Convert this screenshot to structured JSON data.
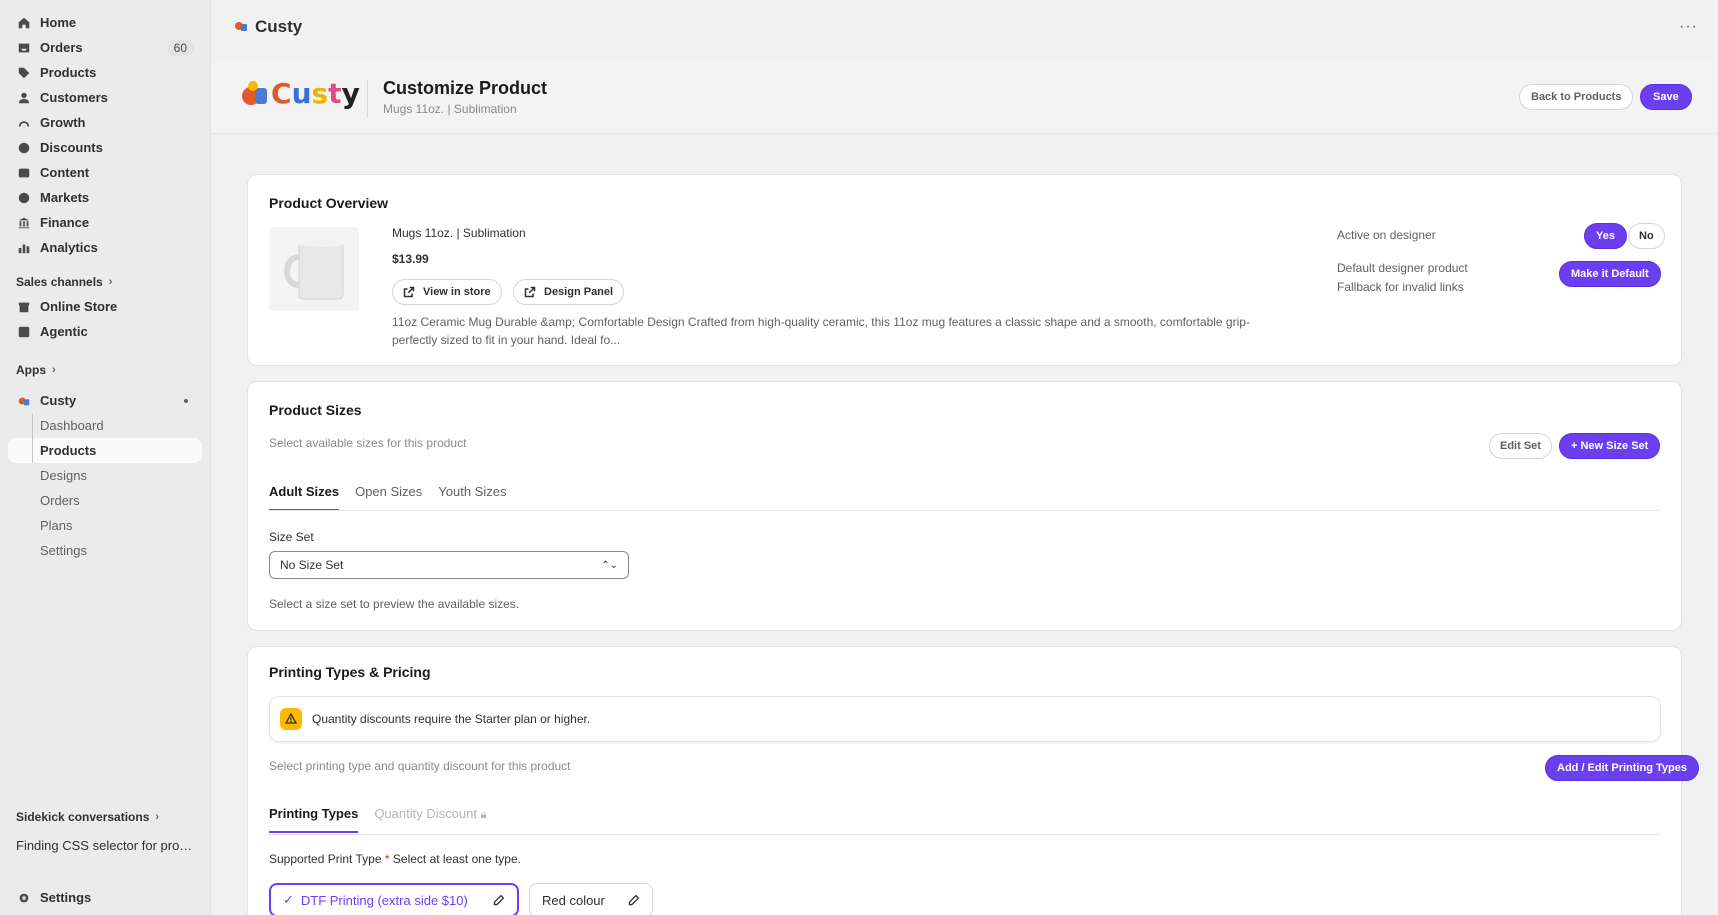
{
  "sidebar": {
    "nav": [
      {
        "label": "Home",
        "icon": "home-icon"
      },
      {
        "label": "Orders",
        "icon": "inbox-icon",
        "badge": "60"
      },
      {
        "label": "Products",
        "icon": "tag-icon"
      },
      {
        "label": "Customers",
        "icon": "person-icon"
      },
      {
        "label": "Growth",
        "icon": "gauge-icon"
      },
      {
        "label": "Discounts",
        "icon": "discount-icon"
      },
      {
        "label": "Content",
        "icon": "content-icon"
      },
      {
        "label": "Markets",
        "icon": "globe-icon"
      },
      {
        "label": "Finance",
        "icon": "bank-icon"
      },
      {
        "label": "Analytics",
        "icon": "bar-chart-icon"
      }
    ],
    "sales_channels_label": "Sales channels",
    "channels": [
      {
        "label": "Online Store",
        "icon": "store-icon"
      },
      {
        "label": "Agentic",
        "icon": "agentic-icon"
      }
    ],
    "apps_label": "Apps",
    "app_name": "Custy",
    "app_items": [
      "Dashboard",
      "Products",
      "Designs",
      "Orders",
      "Plans",
      "Settings"
    ],
    "active_app_item": "Products",
    "sidekick_label": "Sidekick conversations",
    "sidekick_item": "Finding CSS selector for produ...",
    "settings_label": "Settings"
  },
  "topbar": {
    "app_title": "Custy",
    "more_label": "···"
  },
  "header": {
    "logo_text": "Custy",
    "title": "Customize Product",
    "subtitle": "Mugs 11oz. | Sublimation",
    "back_label": "Back to Products",
    "save_label": "Save"
  },
  "overview": {
    "title": "Product Overview",
    "product_name": "Mugs 11oz. | Sublimation",
    "price": "$13.99",
    "view_in_store": "View in store",
    "design_panel": "Design Panel",
    "description": "11oz Ceramic Mug Durable &amp; Comfortable Design Crafted from high-quality ceramic, this 11oz mug features a classic shape and a smooth, comfortable grip- perfectly sized to fit in your hand. Ideal fo...",
    "active_label": "Active on designer",
    "yes_label": "Yes",
    "no_label": "No",
    "default_label": "Default designer product",
    "fallback_label": "Fallback for invalid links",
    "make_default_label": "Make it Default"
  },
  "sizes": {
    "title": "Product Sizes",
    "hint": "Select available sizes for this product",
    "edit_set_label": "Edit Set",
    "new_set_label": "+ New Size Set",
    "tabs": [
      "Adult Sizes",
      "Open Sizes",
      "Youth Sizes"
    ],
    "size_set_label": "Size Set",
    "size_set_value": "No Size Set",
    "preview_hint": "Select a size set to preview the available sizes."
  },
  "printing": {
    "title": "Printing Types & Pricing",
    "banner_text": "Quantity discounts require the Starter plan or higher.",
    "hint": "Select printing type and quantity discount for this product",
    "add_edit_label": "Add / Edit Printing Types",
    "tabs": [
      "Printing Types",
      "Quantity Discount"
    ],
    "supported_label": "Supported Print Type",
    "required_mark": "*",
    "supported_hint": "Select at least one type.",
    "types": [
      "DTF Printing (extra side $10)",
      "Red colour"
    ]
  },
  "colors": {
    "accent": "#6b3ff0",
    "warning": "#ffb800"
  }
}
